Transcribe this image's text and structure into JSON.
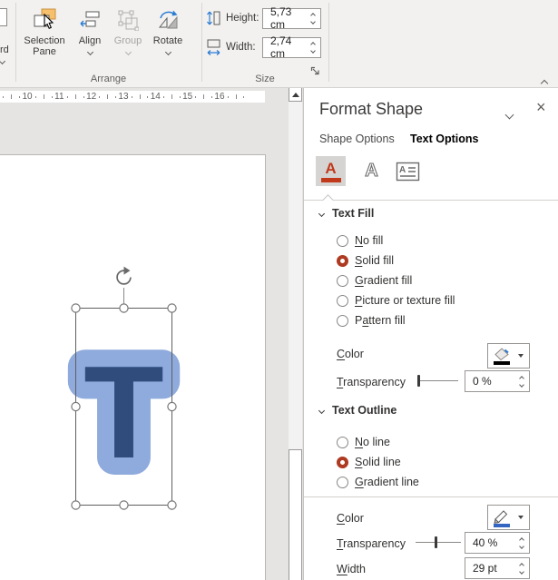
{
  "ribbon": {
    "clipped_button": {
      "label": "rd"
    },
    "buttons": {
      "selection_pane": {
        "line1": "Selection",
        "line2": "Pane"
      },
      "align": {
        "label": "Align"
      },
      "group": {
        "label": "Group",
        "disabled": true
      },
      "rotate": {
        "label": "Rotate"
      }
    },
    "group_labels": {
      "arrange": "Arrange",
      "size": "Size"
    },
    "size_fields": {
      "height": {
        "label": "Height:",
        "value": "5,73 cm"
      },
      "width": {
        "label": "Width:",
        "value": "2,74 cm"
      }
    }
  },
  "ruler": {
    "numbers": [
      "10",
      "11",
      "12",
      "13",
      "14",
      "15",
      "16"
    ]
  },
  "canvas": {
    "shape": {
      "letter": "T",
      "fill_color": "#2F4C7C",
      "outline_color": "#8FAADC"
    }
  },
  "panel": {
    "title": "Format Shape",
    "close_glyph": "×",
    "tabs": {
      "shape_options": {
        "label": "Shape Options",
        "active": false
      },
      "text_options": {
        "label": "Text Options",
        "active": true
      }
    },
    "icon_row": {
      "letter": "A",
      "accent_red": "#c0391b"
    },
    "text_fill": {
      "title": "Text Fill",
      "options": [
        {
          "pre": "",
          "key": "N",
          "rest": "o fill",
          "selected": false
        },
        {
          "pre": "",
          "key": "S",
          "rest": "olid fill",
          "selected": true
        },
        {
          "pre": "",
          "key": "G",
          "rest": "radient fill",
          "selected": false
        },
        {
          "pre": "",
          "key": "P",
          "rest": "icture or texture fill",
          "selected": false
        },
        {
          "pre": "P",
          "key": "a",
          "rest": "ttern fill",
          "selected": false
        }
      ],
      "color_label": {
        "pre": "",
        "key": "C",
        "rest": "olor"
      },
      "transparency_label": {
        "pre": "",
        "key": "T",
        "rest": "ransparency"
      },
      "transparency_value": "0 %"
    },
    "text_outline": {
      "title": "Text Outline",
      "options": [
        {
          "pre": "",
          "key": "N",
          "rest": "o line",
          "selected": false
        },
        {
          "pre": "",
          "key": "S",
          "rest": "olid line",
          "selected": true
        },
        {
          "pre": "",
          "key": "G",
          "rest": "radient line",
          "selected": false
        }
      ],
      "color_label": {
        "pre": "",
        "key": "C",
        "rest": "olor"
      },
      "transparency_label": {
        "pre": "",
        "key": "T",
        "rest": "ransparency"
      },
      "transparency_value": "40 %",
      "width_label": {
        "pre": "",
        "key": "W",
        "rest": "idth"
      },
      "width_value": "29 pt"
    }
  }
}
